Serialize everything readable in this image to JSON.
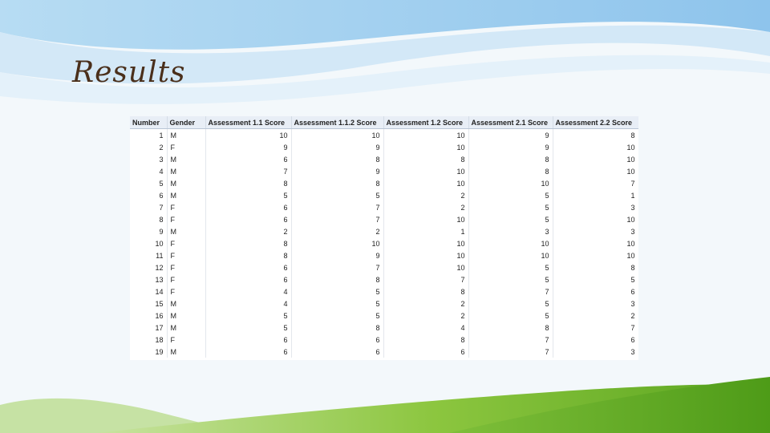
{
  "slide": {
    "title": "Results",
    "colors": {
      "title": "#4a2f1b",
      "sky": "#9fcdee",
      "grass": "#6eb52c"
    }
  },
  "table": {
    "headers": [
      "Number",
      "Gender",
      "Assessment 1.1 Score",
      "Assessment 1.1.2 Score",
      "Assessment 1.2 Score",
      "Assessment 2.1 Score",
      "Assessment 2.2 Score"
    ],
    "rows": [
      [
        "1",
        "M",
        "10",
        "10",
        "10",
        "9",
        "8"
      ],
      [
        "2",
        "F",
        "9",
        "9",
        "10",
        "9",
        "10"
      ],
      [
        "3",
        "M",
        "6",
        "8",
        "8",
        "8",
        "10"
      ],
      [
        "4",
        "M",
        "7",
        "9",
        "10",
        "8",
        "10"
      ],
      [
        "5",
        "M",
        "8",
        "8",
        "10",
        "10",
        "7"
      ],
      [
        "6",
        "M",
        "5",
        "5",
        "2",
        "5",
        "1"
      ],
      [
        "7",
        "F",
        "6",
        "7",
        "2",
        "5",
        "3"
      ],
      [
        "8",
        "F",
        "6",
        "7",
        "10",
        "5",
        "10"
      ],
      [
        "9",
        "M",
        "2",
        "2",
        "1",
        "3",
        "3"
      ],
      [
        "10",
        "F",
        "8",
        "10",
        "10",
        "10",
        "10"
      ],
      [
        "11",
        "F",
        "8",
        "9",
        "10",
        "10",
        "10"
      ],
      [
        "12",
        "F",
        "6",
        "7",
        "10",
        "5",
        "8"
      ],
      [
        "13",
        "F",
        "6",
        "8",
        "7",
        "5",
        "5"
      ],
      [
        "14",
        "F",
        "4",
        "5",
        "8",
        "7",
        "6"
      ],
      [
        "15",
        "M",
        "4",
        "5",
        "2",
        "5",
        "3"
      ],
      [
        "16",
        "M",
        "5",
        "5",
        "2",
        "5",
        "2"
      ],
      [
        "17",
        "M",
        "5",
        "8",
        "4",
        "8",
        "7"
      ],
      [
        "18",
        "F",
        "6",
        "6",
        "8",
        "7",
        "6"
      ],
      [
        "19",
        "M",
        "6",
        "6",
        "6",
        "7",
        "3"
      ]
    ]
  }
}
